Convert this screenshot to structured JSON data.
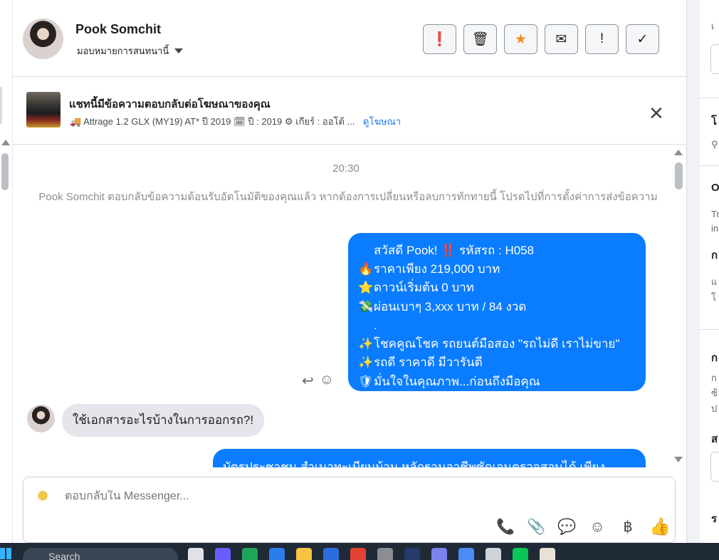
{
  "contact": {
    "name": "Pook Somchit",
    "assign_label": "มอบหมายการสนทนานี้"
  },
  "header_actions": [
    {
      "icon": "alert-circle-icon",
      "glyph": "❗"
    },
    {
      "icon": "trash-icon",
      "glyph": "🗑"
    },
    {
      "icon": "star-icon",
      "glyph": "★"
    },
    {
      "icon": "mail-blocked-icon",
      "glyph": "✉"
    },
    {
      "icon": "exclamation-icon",
      "glyph": "!"
    },
    {
      "icon": "checkmark-icon",
      "glyph": "✓"
    }
  ],
  "ad_banner": {
    "title": "แชทนี้มีข้อความตอบกลับต่อโฆษณาของคุณ",
    "subtitle": "🚚 Attrage 1.2 GLX (MY19) AT* ปี 2019 🗓 ปี : 2019 ⚙ เกียร์ : ออโต้ ...",
    "link": "ดูโฆษณา",
    "close_glyph": "✕"
  },
  "thread": {
    "timestamp": "20:30",
    "system_message": "Pook Somchit ตอบกลับข้อความต้อนรับอัตโนมัติของคุณแล้ว หากต้องการเปลี่ยนหรือลบการทักทายนี้ โปรดไปที่การตั้งค่าการส่งข้อความ",
    "outgoing_1": [
      {
        "emoji": "",
        "text": "สวัสดี Pook! ‼️ รหัสรถ : H058"
      },
      {
        "emoji": "🔥",
        "text": "ราคาเพียง 219,000 บาท"
      },
      {
        "emoji": "⭐",
        "text": "ดาวน์เริ่มต้น 0 บาท"
      },
      {
        "emoji": "💸",
        "text": "ผ่อนเบาๆ 3,xxx บาท / 84 งวด"
      },
      {
        "emoji": "",
        "text": "."
      },
      {
        "emoji": "✨",
        "text": "โชคคูณโชค รถยนต์มือสอง \"รถไม่ดี เราไม่ขาย\""
      },
      {
        "emoji": "✨",
        "text": "รถดี ราคาดี มีวารันตี"
      },
      {
        "emoji": "🛡",
        "text": "มั่นใจในคุณภาพ...ก่อนถึงมือคุณ"
      }
    ],
    "incoming_1": "ใช้เอกสารอะไรบ้างในการออกรถ?!",
    "outgoing_2": "บัตรประชาชน สำเนาทะเบียนบ้าน หลักฐานอาชีพซัดเจนตรวจสอบได้ เพียง"
  },
  "composer": {
    "placeholder": "ตอบกลับใน Messenger..."
  },
  "composer_tools": [
    {
      "icon": "phone-add-icon",
      "glyph": "📞"
    },
    {
      "icon": "paperclip-icon",
      "glyph": "📎"
    },
    {
      "icon": "chat-bubble-icon",
      "glyph": "💬"
    },
    {
      "icon": "emoji-icon",
      "glyph": "☺"
    },
    {
      "icon": "baht-icon",
      "glyph": "฿"
    },
    {
      "icon": "thumbs-up-icon",
      "glyph": "👍"
    }
  ],
  "right_panel": {
    "chars": [
      "เ",
      "โ",
      "O",
      "Tr",
      "in",
      "ก",
      "แ",
      "โ",
      "ก",
      "ก",
      "ซ้",
      "ป",
      "ส",
      "ร"
    ]
  },
  "taskbar": {
    "search_label": "Search"
  }
}
